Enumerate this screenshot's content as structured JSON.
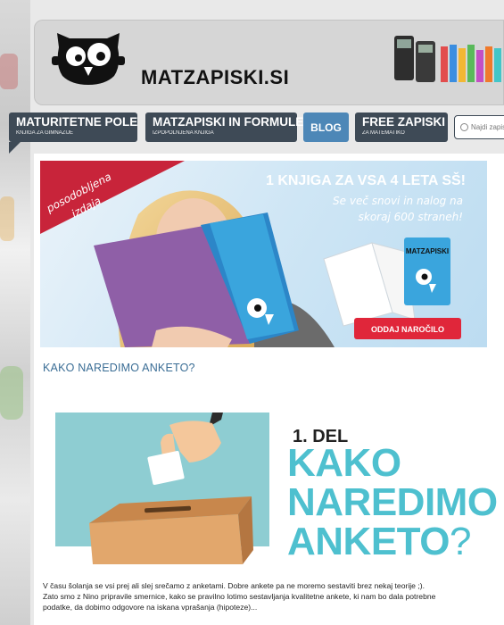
{
  "site": {
    "brand": "MATZAPISKI.SI"
  },
  "nav": [
    {
      "title": "MATURITETNE POLE",
      "sub": "KNJIGA ZA GIMNAZIJE"
    },
    {
      "title": "MATZAPISKI IN FORMULE",
      "sub": "IZPOPOLNJENA KNJIGA"
    },
    {
      "title": "BLOG"
    },
    {
      "title": "FREE ZAPISKI",
      "sub": "ZA MATEMATIKO"
    }
  ],
  "search": {
    "placeholder": "Najdi zapiske"
  },
  "banner": {
    "ribbon_line1": "posodobljena",
    "ribbon_line2": "izdaja",
    "headline": "1 KNJIGA ZA VSA 4 LETA SŠ!",
    "sub_line1": "Se več snovi in nalog na",
    "sub_line2": "skoraj 600 straneh!",
    "button": "ODDAJ NAROČILO",
    "book_title": "MATZAPISKI"
  },
  "article": {
    "title": "KAKO NAREDIMO ANKETO?",
    "image_part": "1. DEL",
    "image_line1": "KAKO",
    "image_line2": "NAREDIMO",
    "image_line3": "ANKETO",
    "image_qmark": "?",
    "body_line1": "V času šolanja se vsi prej ali slej srečamo z anketami. Dobre ankete pa ne moremo sestaviti brez nekaj teorije ;).",
    "body_line2": "Zato smo z Nino pripravile smernice, kako se pravilno lotimo sestavljanja kvalitetne ankete, ki nam bo dala potrebne",
    "body_line3": "podatke, da dobimo odgovore na iskana vprašanja (hipoteze)..."
  },
  "colors": {
    "nav": "#3e4a56",
    "blog": "#4d87b7",
    "accent_teal": "#4ec0cf",
    "ribbon": "#c8243a",
    "title_blue": "#3a6d95"
  }
}
